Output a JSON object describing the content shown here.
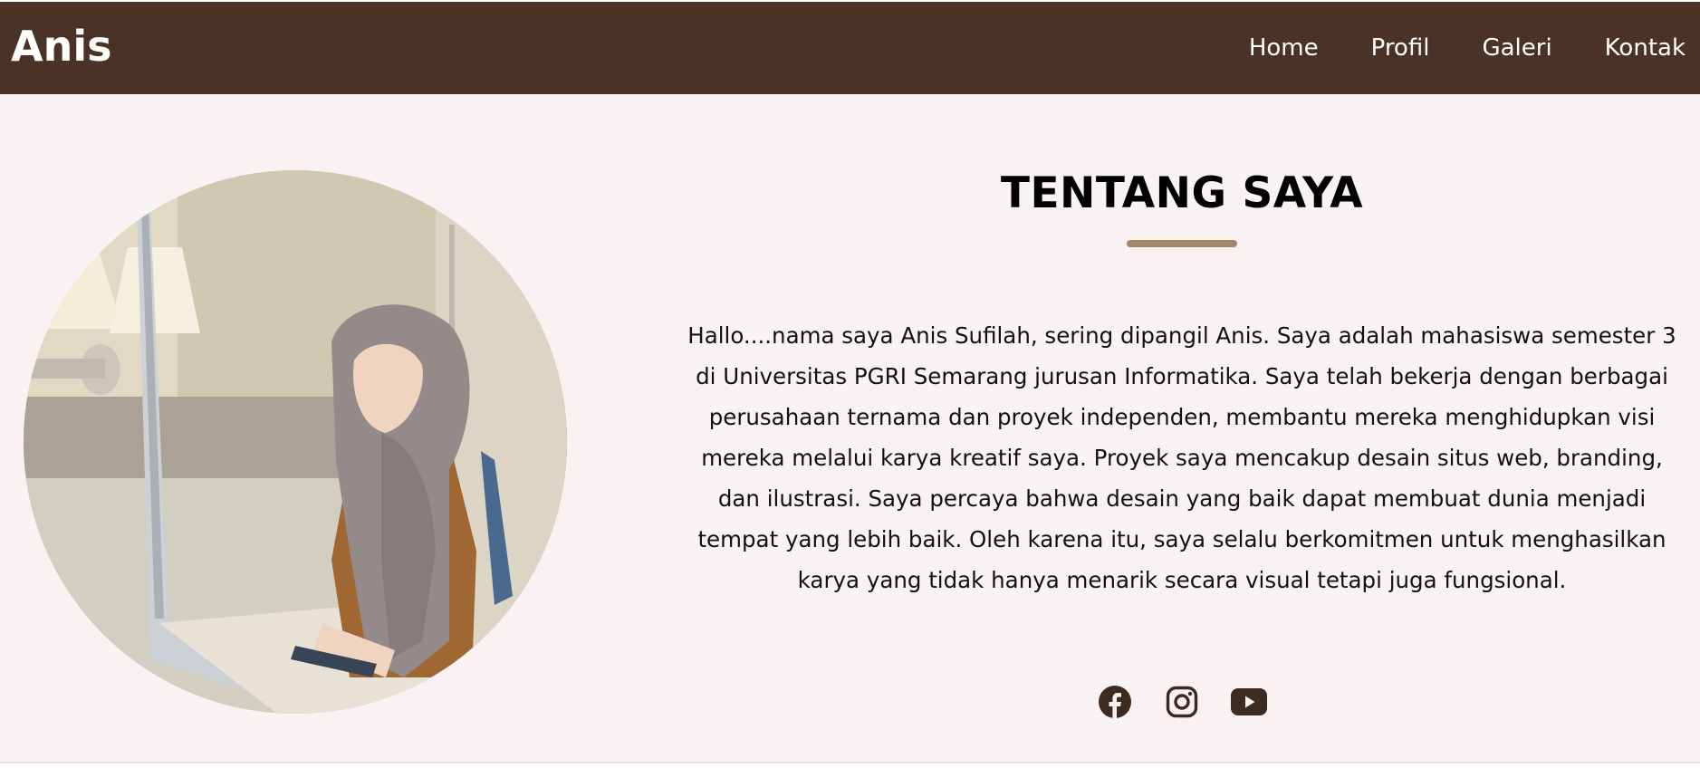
{
  "header": {
    "brand": "Anis",
    "nav": [
      {
        "label": "Home"
      },
      {
        "label": "Profil"
      },
      {
        "label": "Galeri"
      },
      {
        "label": "Kontak"
      }
    ]
  },
  "about": {
    "title": "TENTANG SAYA",
    "bio": "Hallo....nama saya Anis Sufilah, sering dipangil Anis. Saya adalah mahasiswa semester 3 di Universitas PGRI Semarang jurusan Informatika. Saya telah bekerja dengan berbagai perusahaan ternama dan proyek independen, membantu mereka menghidupkan visi mereka melalui karya kreatif saya. Proyek saya mencakup desain situs web, branding, dan ilustrasi. Saya percaya bahwa desain yang baik dapat membuat dunia menjadi tempat yang lebih baik. Oleh karena itu, saya selalu berkomitmen untuk menghasilkan karya yang tidak hanya menarik secara visual tetapi juga fungsional.",
    "socials": [
      {
        "icon": "facebook-icon"
      },
      {
        "icon": "instagram-icon"
      },
      {
        "icon": "youtube-icon"
      }
    ]
  },
  "colors": {
    "navbar": "#4a3326",
    "accent": "#a3876b",
    "section_bg": "#f8f2f2",
    "icon": "#3d2a20"
  }
}
